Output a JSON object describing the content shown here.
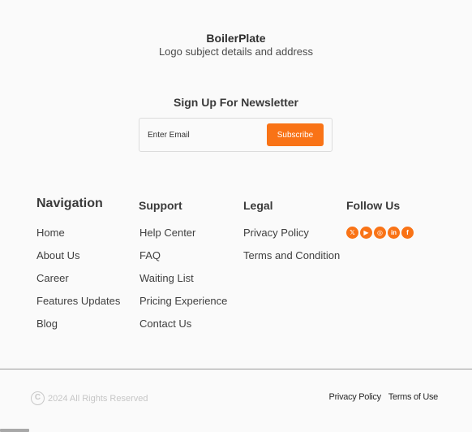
{
  "brand": {
    "name": "BoilerPlate",
    "subtitle": "Logo subject details and address"
  },
  "newsletter": {
    "title": "Sign Up For Newsletter",
    "placeholder": "Enter Email",
    "button": "Subscribe",
    "accent_color": "#f97316"
  },
  "navigation": {
    "title": "Navigation",
    "links": [
      "Home",
      "About Us",
      "Career",
      "Features Updates",
      "Blog"
    ]
  },
  "support": {
    "title": "Support",
    "links": [
      "Help Center",
      "FAQ",
      "Waiting List",
      "Pricing Experience",
      "Contact Us"
    ]
  },
  "legal": {
    "title": "Legal",
    "links": [
      "Privacy Policy",
      "Terms and Condition"
    ]
  },
  "follow": {
    "title": "Follow Us",
    "icons": [
      "x-icon",
      "youtube-icon",
      "instagram-icon",
      "linkedin-icon",
      "facebook-icon"
    ]
  },
  "footer": {
    "copyright": "2024 All Rights Reserved",
    "privacy": "Privacy Policy",
    "terms": "Terms of Use"
  }
}
